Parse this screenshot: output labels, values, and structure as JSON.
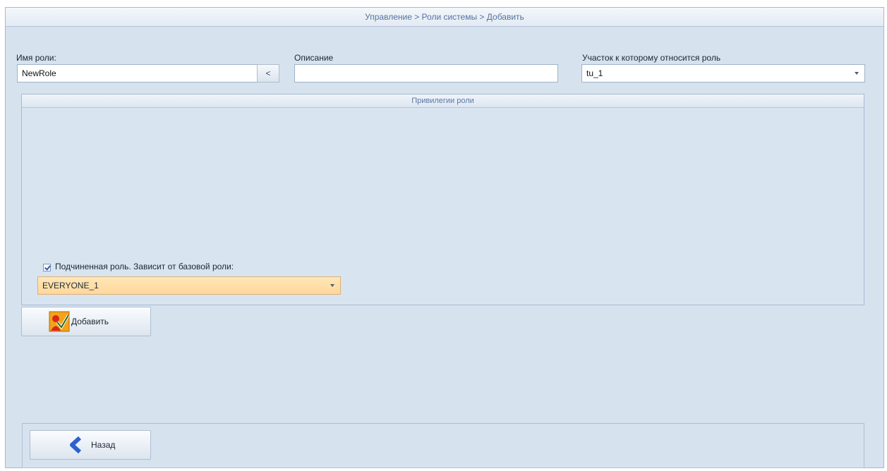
{
  "breadcrumb": "Управление > Роли системы > Добавить",
  "role_name": {
    "label": "Имя роли:",
    "value": "NewRole",
    "copy_button": "<"
  },
  "description": {
    "label": "Описание",
    "value": ""
  },
  "site": {
    "label": "Участок к которому относится роль",
    "value": "tu_1"
  },
  "privileges": {
    "title": "Привилегии роли",
    "subordinate_checkbox": {
      "label": "Подчиненная роль. Зависит от базовой роли:",
      "checked": true
    },
    "base_role": "EVERYONE_1"
  },
  "add_button": {
    "label": "Добавить",
    "icon": "role-add-icon"
  },
  "back_button": {
    "label": "Назад",
    "icon": "chevron-left-icon"
  },
  "colors": {
    "accent_orange": "#ffd79a",
    "panel_bg": "#d7e2ef",
    "header_text": "#5672a0"
  }
}
